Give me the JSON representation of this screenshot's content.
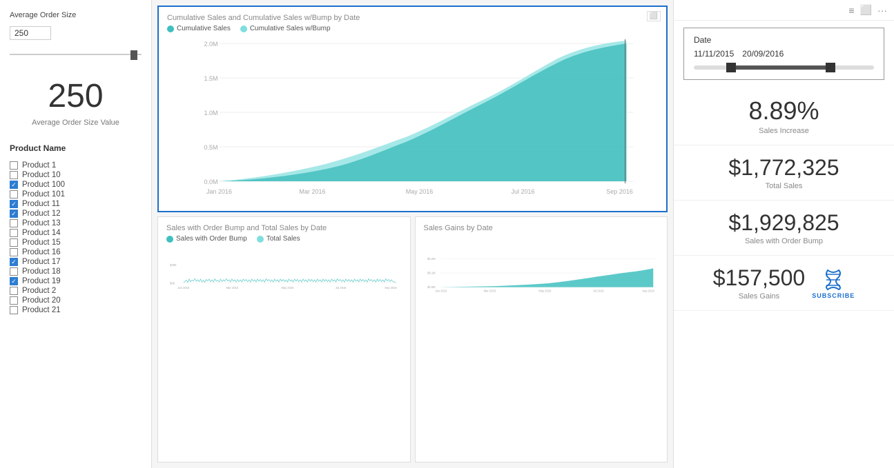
{
  "leftPanel": {
    "sliderLabel": "Average Order Size",
    "sliderValue": "250",
    "bigValue": "250",
    "bigValueLabel": "Average Order Size Value",
    "productFilterLabel": "Product Name",
    "products": [
      {
        "name": "Product 1",
        "checked": false
      },
      {
        "name": "Product 10",
        "checked": false
      },
      {
        "name": "Product 100",
        "checked": true
      },
      {
        "name": "Product 101",
        "checked": false
      },
      {
        "name": "Product 11",
        "checked": true
      },
      {
        "name": "Product 12",
        "checked": true
      },
      {
        "name": "Product 13",
        "checked": false
      },
      {
        "name": "Product 14",
        "checked": false
      },
      {
        "name": "Product 15",
        "checked": false
      },
      {
        "name": "Product 16",
        "checked": false
      },
      {
        "name": "Product 17",
        "checked": true
      },
      {
        "name": "Product 18",
        "checked": false
      },
      {
        "name": "Product 19",
        "checked": true
      },
      {
        "name": "Product 2",
        "checked": false
      },
      {
        "name": "Product 20",
        "checked": false
      },
      {
        "name": "Product 21",
        "checked": false
      }
    ]
  },
  "mainCharts": {
    "chart1": {
      "title": "Cumulative Sales and Cumulative Sales w/Bump by Date",
      "legend1": "Cumulative Sales",
      "legend2": "Cumulative Sales w/Bump",
      "color1": "#40bfbf",
      "color2": "#80dede",
      "xLabels": [
        "Jan 2016",
        "Mar 2016",
        "May 2016",
        "Jul 2016",
        "Sep 2016"
      ],
      "yLabels": [
        "2.0M",
        "1.5M",
        "1.0M",
        "0.5M",
        "0.0M"
      ]
    },
    "chart2": {
      "title": "Sales with Order Bump and Total Sales by Date",
      "legend1": "Sales with Order Bump",
      "legend2": "Total Sales",
      "color1": "#40bfbf",
      "color2": "#80dede",
      "xLabels": [
        "Jan 2016",
        "Mar 2016",
        "May 2016",
        "Jul 2016",
        "Sep 2016"
      ],
      "yLabels": [
        "$20K",
        "$0K"
      ]
    },
    "chart3": {
      "title": "Sales Gains by Date",
      "xLabels": [
        "Jan 2016",
        "Mar 2016",
        "May 2016",
        "Jul 2016",
        "Sep 2016"
      ],
      "yLabels": [
        "$0.2M",
        "$0.1M",
        "$0.0M"
      ]
    }
  },
  "rightPanel": {
    "dateLabel": "Date",
    "dateStart": "11/11/2015",
    "dateEnd": "20/09/2016",
    "metrics": [
      {
        "value": "8.89%",
        "label": "Sales Increase"
      },
      {
        "value": "$1,772,325",
        "label": "Total Sales"
      },
      {
        "value": "$1,929,825",
        "label": "Sales with Order Bump"
      },
      {
        "value": "$157,500",
        "label": "Sales Gains"
      }
    ],
    "subscribeText": "SUBSCRIBE"
  }
}
